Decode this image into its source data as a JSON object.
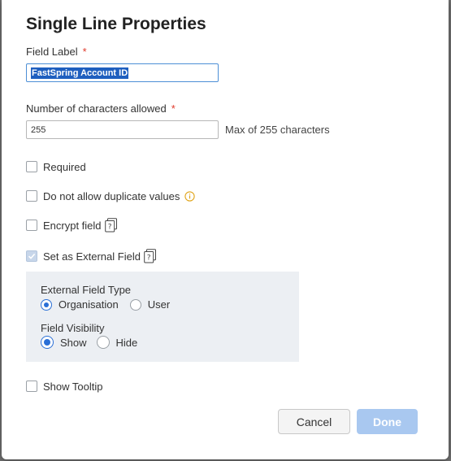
{
  "dialog": {
    "title": "Single Line Properties",
    "field_label": {
      "label": "Field Label",
      "required_mark": "*",
      "value": "FastSpring Account ID"
    },
    "char_limit": {
      "label": "Number of characters allowed",
      "required_mark": "*",
      "value": "255",
      "hint": "Max of 255 characters"
    },
    "options": {
      "required": {
        "label": "Required",
        "checked": false
      },
      "no_duplicates": {
        "label": "Do not allow duplicate values",
        "checked": false,
        "icon": "info-icon"
      },
      "encrypt": {
        "label": "Encrypt field",
        "checked": false,
        "icon": "document-help-icon"
      },
      "external": {
        "label": "Set as External Field",
        "checked": true,
        "icon": "document-help-icon"
      },
      "tooltip": {
        "label": "Show Tooltip",
        "checked": false
      }
    },
    "external_panel": {
      "type_label": "External Field Type",
      "type_options": [
        {
          "label": "Organisation",
          "selected": true
        },
        {
          "label": "User",
          "selected": false
        }
      ],
      "visibility_label": "Field Visibility",
      "visibility_options": [
        {
          "label": "Show",
          "selected": true
        },
        {
          "label": "Hide",
          "selected": false
        }
      ]
    },
    "buttons": {
      "cancel": "Cancel",
      "done": "Done"
    },
    "colors": {
      "accent": "#2a6fd6",
      "done_disabled_bg": "#a9c8f0",
      "required_mark": "#e0392b",
      "panel_bg": "#eceff3"
    }
  }
}
